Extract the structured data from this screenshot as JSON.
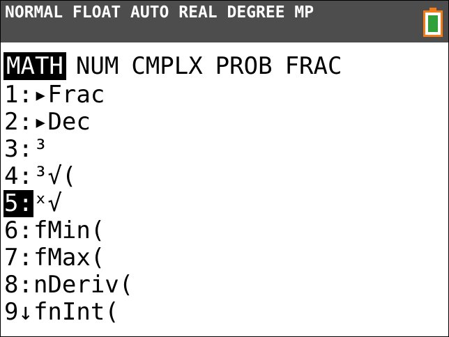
{
  "status_bar": {
    "text": "NORMAL FLOAT AUTO REAL DEGREE MP",
    "battery_color": "#f07c1a",
    "battery_fill_color": "#2fa03a"
  },
  "tabs": [
    {
      "label": "MATH",
      "active": true
    },
    {
      "label": "NUM",
      "active": false
    },
    {
      "label": "CMPLX",
      "active": false
    },
    {
      "label": "PROB",
      "active": false
    },
    {
      "label": "FRAC",
      "active": false
    }
  ],
  "menu": {
    "items": [
      {
        "num": "1:",
        "label": "▸Frac"
      },
      {
        "num": "2:",
        "label": "▸Dec"
      },
      {
        "num": "3:",
        "label": "³"
      },
      {
        "num": "4:",
        "label": "³√("
      },
      {
        "num": "5:",
        "label": "ˣ√"
      },
      {
        "num": "6:",
        "label": "fMin("
      },
      {
        "num": "7:",
        "label": "fMax("
      },
      {
        "num": "8:",
        "label": "nDeriv("
      },
      {
        "num": "9↓",
        "label": "fnInt("
      }
    ],
    "selected": "5:"
  }
}
